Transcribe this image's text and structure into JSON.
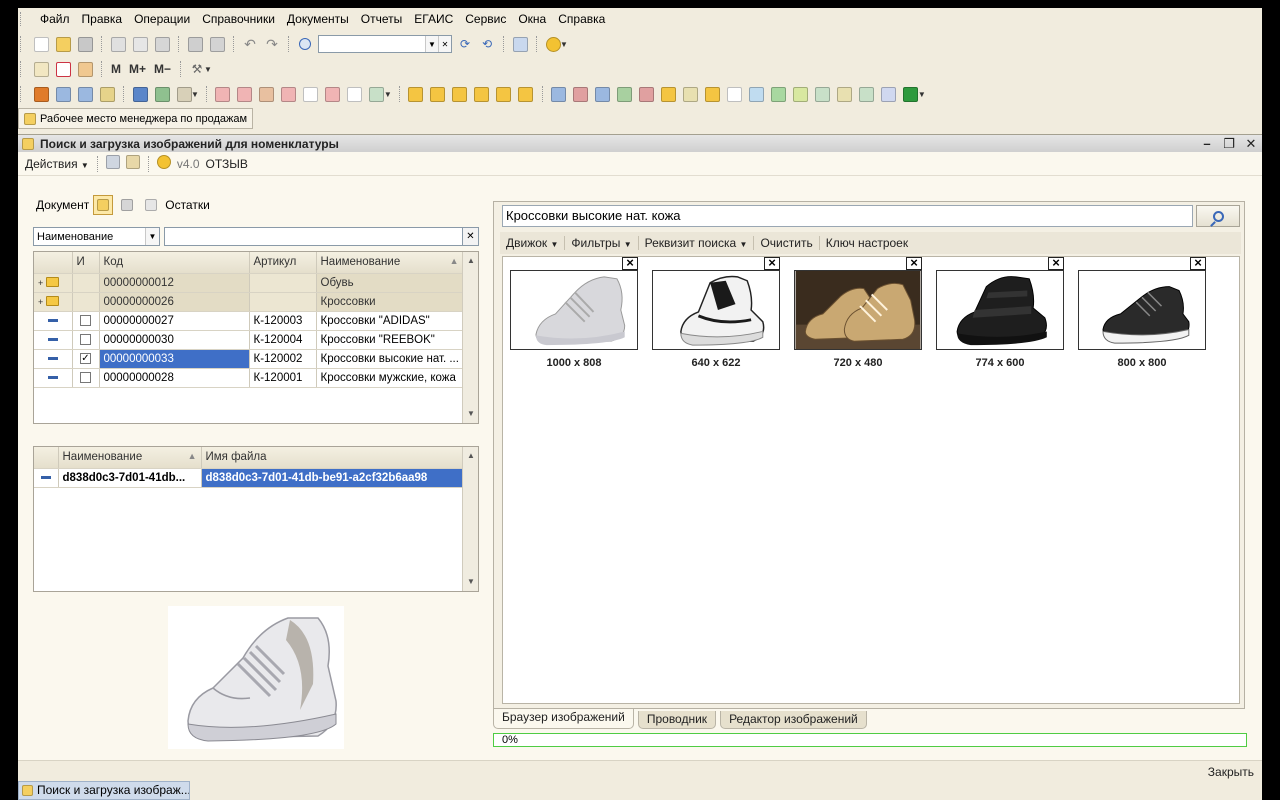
{
  "menu": [
    "Файл",
    "Правка",
    "Операции",
    "Справочники",
    "Документы",
    "Отчеты",
    "ЕГАИС",
    "Сервис",
    "Окна",
    "Справка"
  ],
  "toolbar2": {
    "m": "M",
    "mplus": "M+",
    "mminus": "M−"
  },
  "workplace_panel": "Рабочее место менеджера по продажам",
  "window": {
    "title": "Поиск и загрузка изображений для номенклатуры",
    "actions": "Действия",
    "version": "v4.0",
    "feedback": "ОТЗЫВ"
  },
  "left": {
    "document_label": "Документ",
    "stock_label": "Остатки",
    "filter_field": "Наименование",
    "filter_value": "",
    "grid": {
      "headers": {
        "i": "И",
        "code": "Код",
        "article": "Артикул",
        "name": "Наименование"
      },
      "rows": [
        {
          "type": "folder",
          "code": "00000000012",
          "article": "",
          "name": "Обувь"
        },
        {
          "type": "folder",
          "code": "00000000026",
          "article": "",
          "name": "Кроссовки"
        },
        {
          "type": "item",
          "checked": false,
          "code": "00000000027",
          "article": "К-120003",
          "name": "Кроссовки \"ADIDAS\""
        },
        {
          "type": "item",
          "checked": false,
          "code": "00000000030",
          "article": "К-120004",
          "name": "Кроссовки \"REEBOK\""
        },
        {
          "type": "item",
          "checked": true,
          "code": "00000000033",
          "article": "К-120002",
          "name": "Кроссовки высокие нат. ..."
        },
        {
          "type": "item",
          "checked": false,
          "code": "00000000028",
          "article": "К-120001",
          "name": "Кроссовки мужские, кожа"
        }
      ]
    },
    "files": {
      "headers": {
        "name": "Наименование",
        "filename": "Имя файла"
      },
      "rows": [
        {
          "name": "d838d0c3-7d01-41db...",
          "filename": "d838d0c3-7d01-41db-be91-a2cf32b6aa98"
        }
      ]
    }
  },
  "right": {
    "query": "Кроссовки высокие нат. кожа",
    "toolbar": {
      "engine": "Движок",
      "filters": "Фильтры",
      "search_attr": "Реквизит поиска",
      "clear": "Очистить",
      "settings_key": "Ключ настроек"
    },
    "results": [
      {
        "size": "1000 x 808",
        "bg": "#ffffff",
        "shoe": "#d8d8dc"
      },
      {
        "size": "640 x 622",
        "bg": "#ffffff",
        "shoe": "#f2f2f2"
      },
      {
        "size": "720 x 480",
        "bg": "#3a2c1e",
        "shoe": "#c9a872"
      },
      {
        "size": "774 x 600",
        "bg": "#ffffff",
        "shoe": "#1e1e1e"
      },
      {
        "size": "800 x 800",
        "bg": "#ffffff",
        "shoe": "#2a2a2a"
      }
    ],
    "tabs": [
      "Браузер изображений",
      "Проводник",
      "Редактор изображений"
    ],
    "progress": "0%"
  },
  "footer": {
    "close": "Закрыть"
  },
  "taskbar": {
    "item": "Поиск и загрузка изображ..."
  }
}
